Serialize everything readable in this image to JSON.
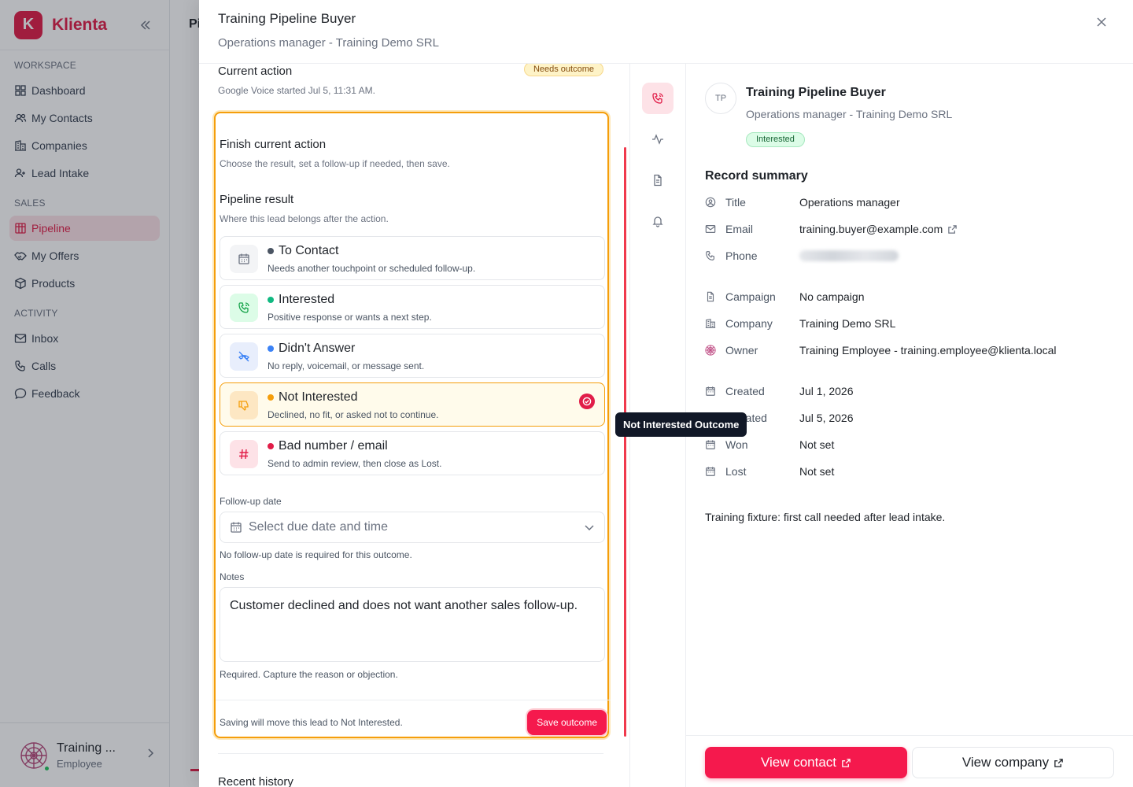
{
  "app": {
    "brand_letter": "K",
    "brand_name": "Klienta",
    "page_peek_title": "Pi"
  },
  "sidebar": {
    "sections": [
      {
        "label": "WORKSPACE",
        "items": [
          "Dashboard",
          "My Contacts",
          "Companies",
          "Lead Intake"
        ]
      },
      {
        "label": "SALES",
        "items": [
          "Pipeline",
          "My Offers",
          "Products"
        ]
      },
      {
        "label": "ACTIVITY",
        "items": [
          "Inbox",
          "Calls",
          "Feedback"
        ]
      }
    ],
    "active_item": "Pipeline",
    "user": {
      "name": "Training ...",
      "role": "Employee"
    }
  },
  "drawer": {
    "title": "Training Pipeline Buyer",
    "subtitle": "Operations manager - Training Demo SRL"
  },
  "current_action": {
    "title": "Current action",
    "badge": "Needs outcome",
    "subtitle": "Google Voice started Jul 5, 11:31 AM."
  },
  "outcome": {
    "title": "Finish current action",
    "subtitle": "Choose the result, set a follow-up if needed, then save.",
    "pipeline_title": "Pipeline result",
    "pipeline_subtitle": "Where this lead belongs after the action.",
    "options": [
      {
        "title": "To Contact",
        "desc": "Needs another touchpoint or scheduled follow-up.",
        "dot": "#4b5563",
        "icon": "calendar-icon",
        "selected": false
      },
      {
        "title": "Interested",
        "desc": "Positive response or wants a next step.",
        "dot": "#10b981",
        "icon": "phone-call-icon",
        "selected": false
      },
      {
        "title": "Didn't Answer",
        "desc": "No reply, voicemail, or message sent.",
        "dot": "#3b82f6",
        "icon": "phone-off-icon",
        "selected": false
      },
      {
        "title": "Not Interested",
        "desc": "Declined, no fit, or asked not to continue.",
        "dot": "#f59e0b",
        "icon": "thumbs-down-icon",
        "selected": true
      },
      {
        "title": "Bad number / email",
        "desc": "Send to admin review, then close as Lost.",
        "dot": "#e11d48",
        "icon": "hash-icon",
        "selected": false
      }
    ],
    "followup_label": "Follow-up date",
    "followup_placeholder": "Select due date and time",
    "followup_helper": "No follow-up date is required for this outcome.",
    "notes_label": "Notes",
    "notes_value": "Customer declined and does not want another sales follow-up.",
    "notes_helper": "Required. Capture the reason or objection.",
    "footer_note": "Saving will move this lead to Not Interested.",
    "save_label": "Save outcome"
  },
  "history_title": "Recent history",
  "tooltip": "Not Interested Outcome",
  "record": {
    "initials": "TP",
    "name": "Training Pipeline Buyer",
    "subtitle": "Operations manager - Training Demo SRL",
    "status": "Interested",
    "summary_title": "Record summary",
    "rows": [
      {
        "key": "Title",
        "value": "Operations manager",
        "icon": "user-circle-icon"
      },
      {
        "key": "Email",
        "value": "training.buyer@example.com",
        "icon": "mail-icon"
      },
      {
        "key": "Phone",
        "value": "",
        "icon": "phone-icon"
      },
      {
        "key": "Campaign",
        "value": "No campaign",
        "icon": "file-icon"
      },
      {
        "key": "Company",
        "value": "Training Demo SRL",
        "icon": "building-icon"
      },
      {
        "key": "Owner",
        "value": "Training Employee - training.employee@klienta.local",
        "icon": "avatar-icon"
      },
      {
        "key": "Created",
        "value": "Jul 1, 2026",
        "icon": "calendar-icon"
      },
      {
        "key": "Updated",
        "value": "Jul 5, 2026",
        "icon": "calendar-icon"
      },
      {
        "key": "Won",
        "value": "Not set",
        "icon": "calendar-icon"
      },
      {
        "key": "Lost",
        "value": "Not set",
        "icon": "calendar-icon"
      }
    ],
    "note": "Training fixture: first call needed after lead intake.",
    "view_contact": "View contact",
    "view_company": "View company"
  }
}
